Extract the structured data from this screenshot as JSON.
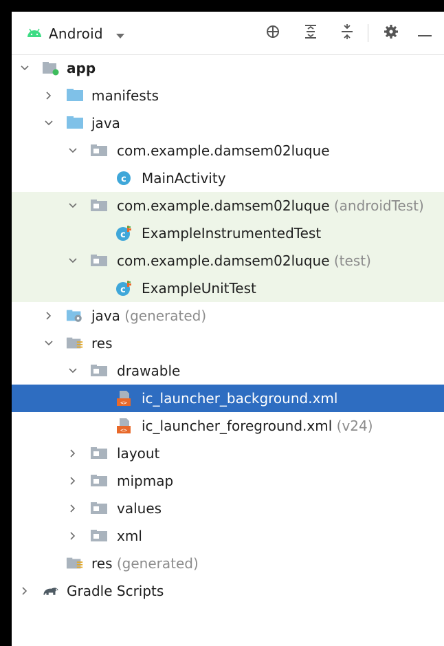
{
  "toolbar": {
    "view_label": "Android",
    "buttons": [
      {
        "name": "select-opened-file-icon"
      },
      {
        "name": "expand-all-icon"
      },
      {
        "name": "collapse-all-icon"
      },
      {
        "name": "gear-icon"
      },
      {
        "name": "minimize-icon"
      }
    ]
  },
  "tree": [
    {
      "name": "app",
      "suffix": "",
      "depth": 0,
      "chevron": "down",
      "icon": "module",
      "bold": true
    },
    {
      "name": "manifests",
      "suffix": "",
      "depth": 1,
      "chevron": "right",
      "icon": "folder-blue"
    },
    {
      "name": "java",
      "suffix": "",
      "depth": 1,
      "chevron": "down",
      "icon": "folder-blue"
    },
    {
      "name": "com.example.damsem02luque",
      "suffix": "",
      "depth": 2,
      "chevron": "down",
      "icon": "package"
    },
    {
      "name": "MainActivity",
      "suffix": "",
      "depth": 3,
      "chevron": "none",
      "icon": "class"
    },
    {
      "name": "com.example.damsem02luque",
      "suffix": "(androidTest)",
      "depth": 2,
      "chevron": "down",
      "icon": "package",
      "bg": "test"
    },
    {
      "name": "ExampleInstrumentedTest",
      "suffix": "",
      "depth": 3,
      "chevron": "none",
      "icon": "test-class",
      "bg": "test"
    },
    {
      "name": "com.example.damsem02luque",
      "suffix": "(test)",
      "depth": 2,
      "chevron": "down",
      "icon": "package",
      "bg": "test"
    },
    {
      "name": "ExampleUnitTest",
      "suffix": "",
      "depth": 3,
      "chevron": "none",
      "icon": "test-class",
      "bg": "test"
    },
    {
      "name": "java",
      "suffix": "(generated)",
      "depth": 1,
      "chevron": "right",
      "icon": "folder-generated"
    },
    {
      "name": "res",
      "suffix": "",
      "depth": 1,
      "chevron": "down",
      "icon": "folder-res"
    },
    {
      "name": "drawable",
      "suffix": "",
      "depth": 2,
      "chevron": "down",
      "icon": "package"
    },
    {
      "name": "ic_launcher_background.xml",
      "suffix": "",
      "depth": 3,
      "chevron": "none",
      "icon": "xml-file",
      "selected": true
    },
    {
      "name": "ic_launcher_foreground.xml",
      "suffix": "(v24)",
      "depth": 3,
      "chevron": "none",
      "icon": "xml-file"
    },
    {
      "name": "layout",
      "suffix": "",
      "depth": 2,
      "chevron": "right",
      "icon": "package"
    },
    {
      "name": "mipmap",
      "suffix": "",
      "depth": 2,
      "chevron": "right",
      "icon": "package"
    },
    {
      "name": "values",
      "suffix": "",
      "depth": 2,
      "chevron": "right",
      "icon": "package"
    },
    {
      "name": "xml",
      "suffix": "",
      "depth": 2,
      "chevron": "right",
      "icon": "package"
    },
    {
      "name": "res",
      "suffix": "(generated)",
      "depth": 1,
      "chevron": "none",
      "icon": "folder-res"
    },
    {
      "name": "Gradle Scripts",
      "suffix": "",
      "depth": 0,
      "chevron": "right",
      "icon": "gradle"
    }
  ]
}
